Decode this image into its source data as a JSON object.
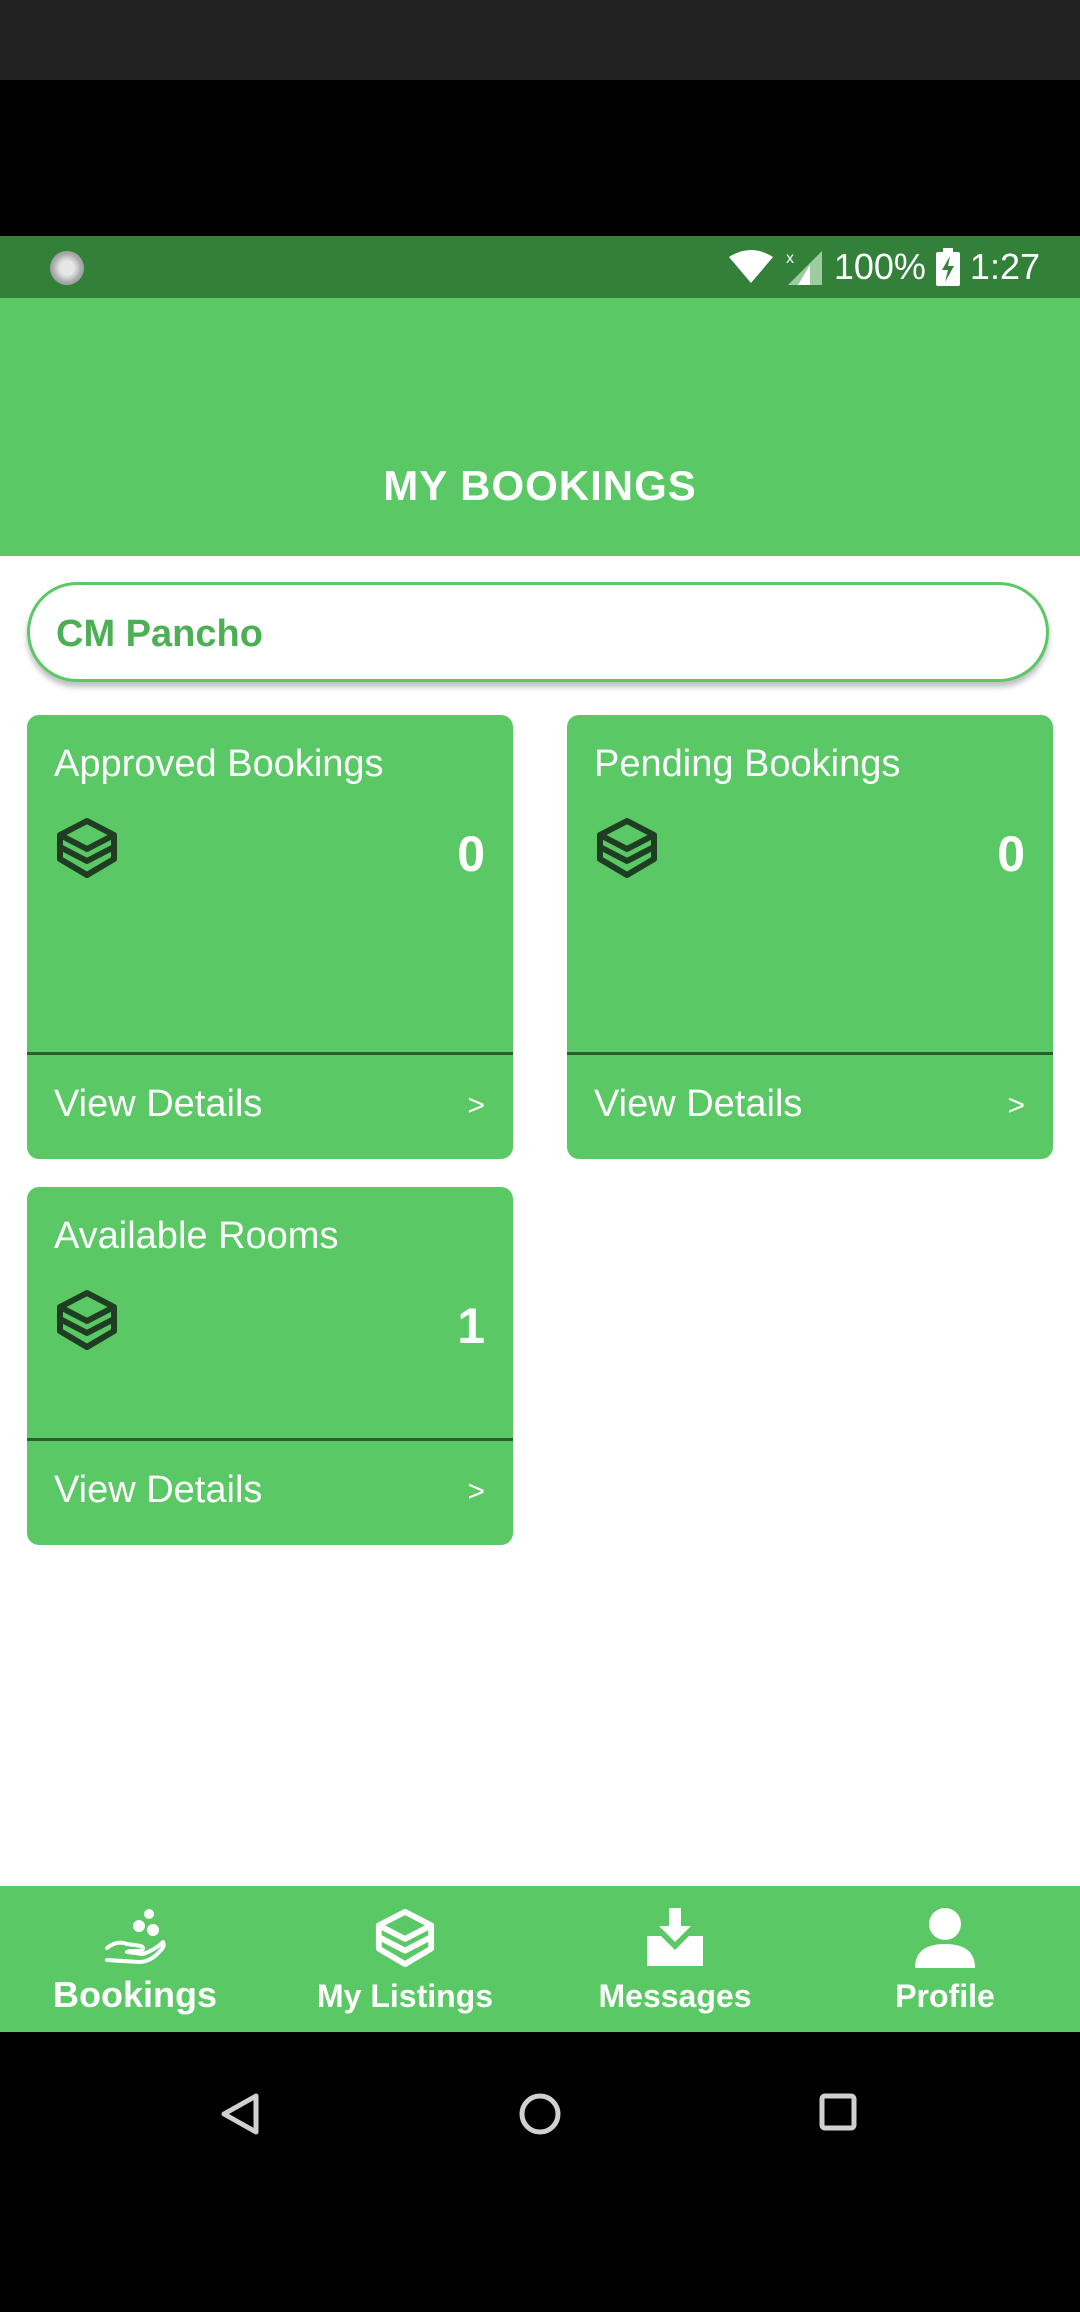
{
  "status_bar": {
    "battery": "100%",
    "time": "1:27"
  },
  "header": {
    "title": "MY BOOKINGS"
  },
  "search": {
    "value": "CM Pancho"
  },
  "cards": [
    {
      "title": "Approved Bookings",
      "count": "0",
      "footer": "View Details",
      "chevron": ">"
    },
    {
      "title": "Pending Bookings",
      "count": "0",
      "footer": "View Details",
      "chevron": ">"
    },
    {
      "title": "Available Rooms",
      "count": "1",
      "footer": "View Details",
      "chevron": ">"
    }
  ],
  "bottom_nav": {
    "items": [
      {
        "label": "Bookings",
        "icon": "hand-coins-icon"
      },
      {
        "label": "My Listings",
        "icon": "box-icon"
      },
      {
        "label": "Messages",
        "icon": "download-inbox-icon"
      },
      {
        "label": "Profile",
        "icon": "person-icon"
      }
    ]
  },
  "colors": {
    "primary": "#5ac864",
    "status_bar": "#338039",
    "divider": "#2c5f30",
    "icon_dark": "#1f3d22"
  }
}
